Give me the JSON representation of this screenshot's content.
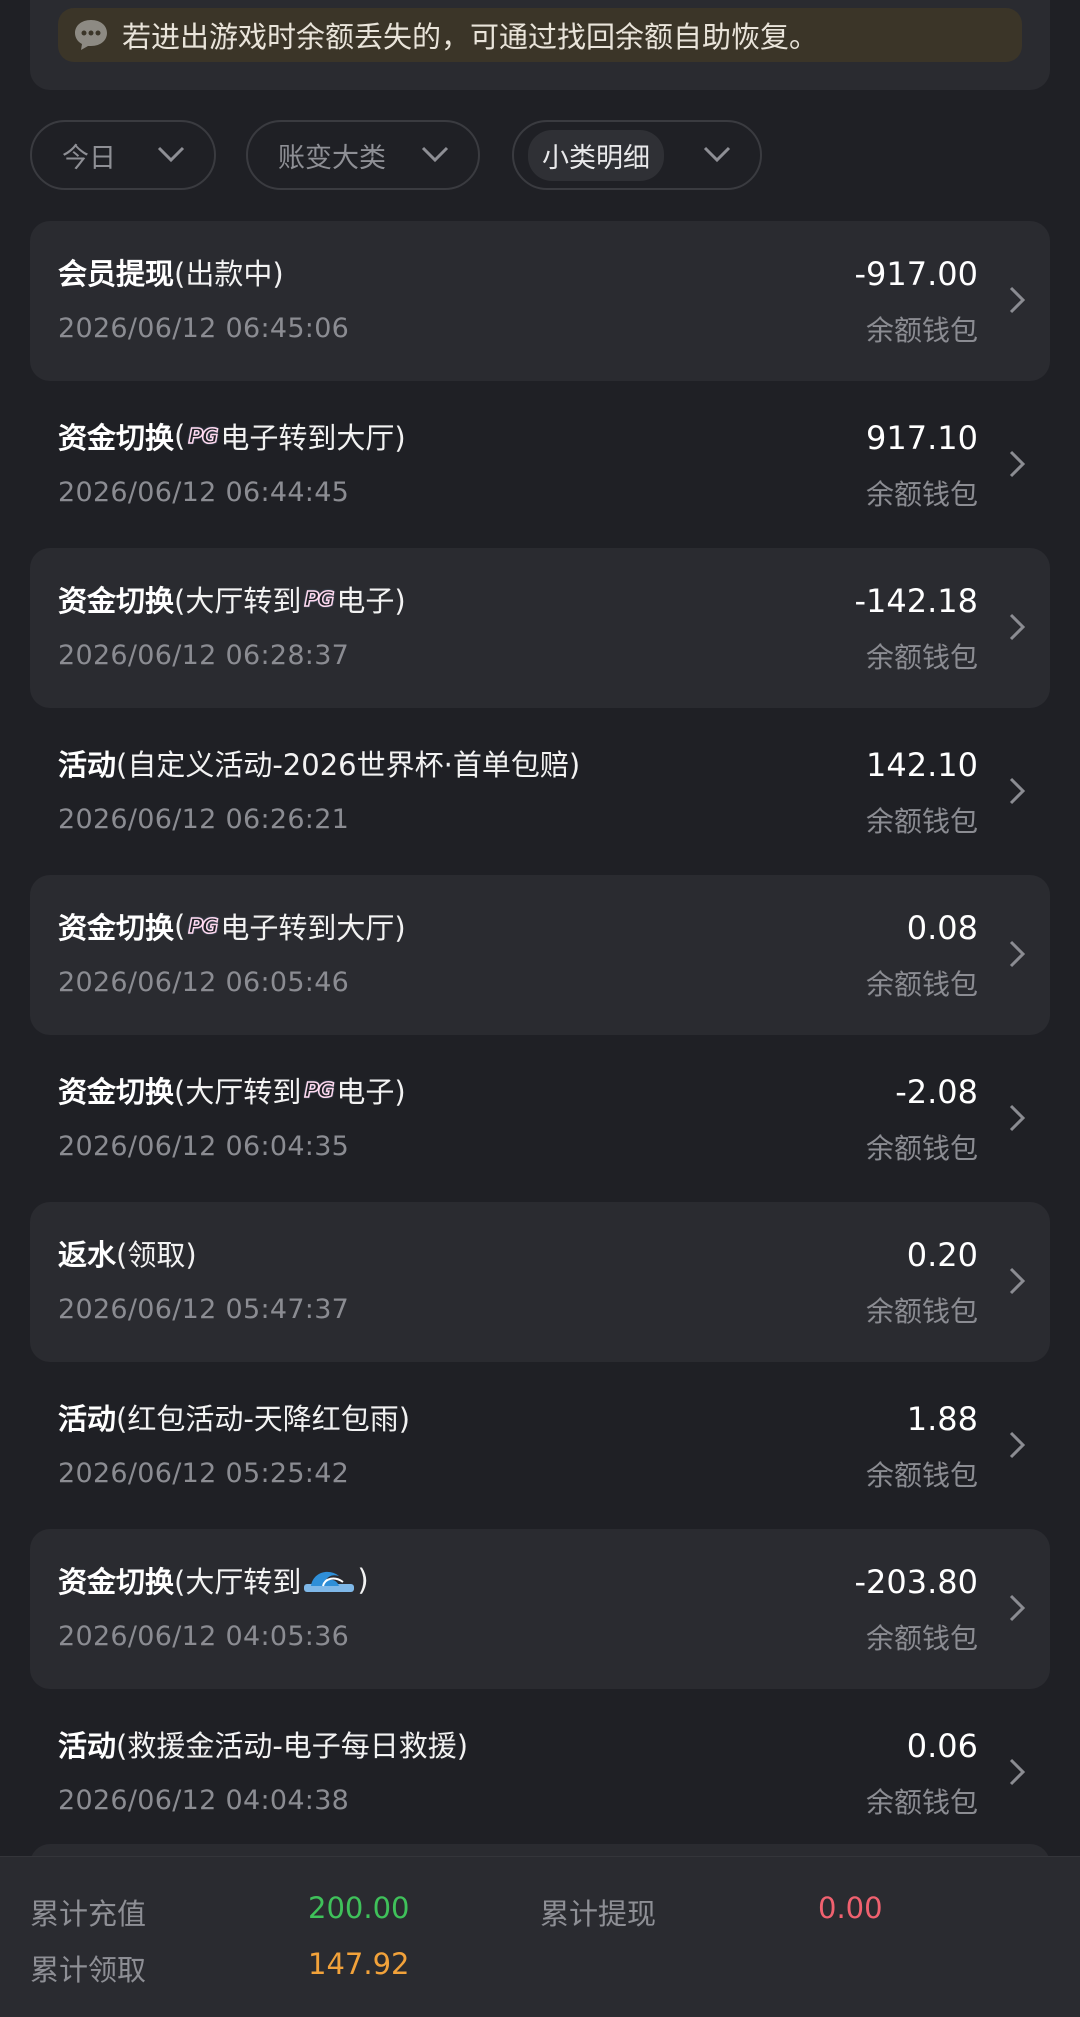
{
  "notice": {
    "icon": "chat-bubble-icon",
    "text": "若进出游戏时余额丢失的，可通过找回余额自助恢复。"
  },
  "filters": [
    {
      "label": "今日",
      "icon": "chevron-down-icon"
    },
    {
      "label": "账变大类",
      "icon": "chevron-down-icon"
    },
    {
      "label": "小类明细",
      "icon": "chevron-down-icon"
    }
  ],
  "pg_logo": "PG",
  "records": [
    {
      "category": "会员提现",
      "detail_prefix": " (出款中)",
      "detail_suffix": "",
      "logo": "",
      "time": "2026/06/12 06:45:06",
      "amount": "-917.00",
      "wallet": "余额钱包"
    },
    {
      "category": "资金切换",
      "detail_prefix": " (",
      "detail_suffix": "电子转到大厅)",
      "logo": "pg",
      "time": "2026/06/12 06:44:45",
      "amount": "917.10",
      "wallet": "余额钱包"
    },
    {
      "category": "资金切换",
      "detail_prefix": " (大厅转到",
      "detail_suffix": "电子)",
      "logo": "pg",
      "time": "2026/06/12 06:28:37",
      "amount": "-142.18",
      "wallet": "余额钱包"
    },
    {
      "category": "活动",
      "detail_prefix": " (自定义活动-2026世界杯·首单包赔)",
      "detail_suffix": "",
      "logo": "",
      "time": "2026/06/12 06:26:21",
      "amount": "142.10",
      "wallet": "余额钱包"
    },
    {
      "category": "资金切换",
      "detail_prefix": " (",
      "detail_suffix": "电子转到大厅)",
      "logo": "pg",
      "time": "2026/06/12 06:05:46",
      "amount": "0.08",
      "wallet": "余额钱包"
    },
    {
      "category": "资金切换",
      "detail_prefix": " (大厅转到",
      "detail_suffix": "电子)",
      "logo": "pg",
      "time": "2026/06/12 06:04:35",
      "amount": "-2.08",
      "wallet": "余额钱包"
    },
    {
      "category": "返水",
      "detail_prefix": " (领取)",
      "detail_suffix": "",
      "logo": "",
      "time": "2026/06/12 05:47:37",
      "amount": "0.20",
      "wallet": "余额钱包"
    },
    {
      "category": "活动",
      "detail_prefix": " (红包活动-天降红包雨)",
      "detail_suffix": "",
      "logo": "",
      "time": "2026/06/12 05:25:42",
      "amount": "1.88",
      "wallet": "余额钱包"
    },
    {
      "category": "资金切换",
      "detail_prefix": " (大厅转到",
      "detail_suffix": ")",
      "logo": "wave",
      "time": "2026/06/12 04:05:36",
      "amount": "-203.80",
      "wallet": "余额钱包"
    },
    {
      "category": "活动",
      "detail_prefix": " (救援金活动-电子每日救援)",
      "detail_suffix": "",
      "logo": "",
      "time": "2026/06/12 04:04:38",
      "amount": "0.06",
      "wallet": "余额钱包"
    }
  ],
  "summary": {
    "recharge_label": "累计充值",
    "recharge_value": "200.00",
    "withdraw_label": "累计提现",
    "withdraw_value": "0.00",
    "claimed_label": "累计领取",
    "claimed_value": "147.92"
  },
  "colors": {
    "recharge": "#3fc15a",
    "withdraw": "#f0616f",
    "claimed": "#f2a23a"
  }
}
